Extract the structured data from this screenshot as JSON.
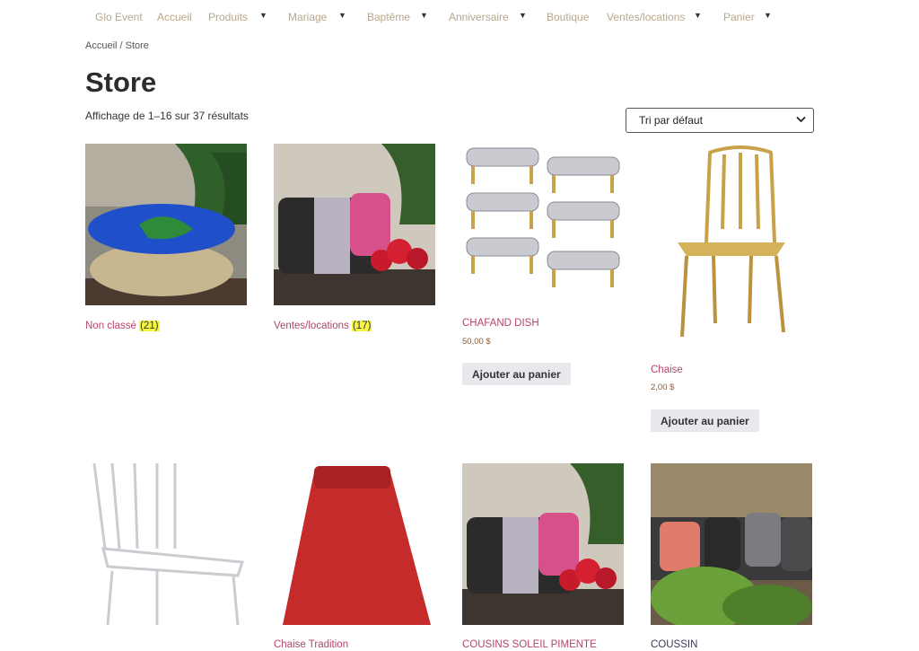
{
  "nav": {
    "items": [
      {
        "label": "Glo Event"
      },
      {
        "label": "Accueil"
      },
      {
        "label": "Produits"
      },
      {
        "label": "Mariage"
      },
      {
        "label": "Baptême"
      },
      {
        "label": "Anniversaire"
      },
      {
        "label": "Boutique"
      },
      {
        "label": "Ventes/locations"
      },
      {
        "label": "Panier"
      }
    ],
    "dropdown_symbol": "▼"
  },
  "breadcrumb": "Accueil / Store",
  "page_title": "Store",
  "result_count": "Affichage de 1–16 sur 37 résultats",
  "sort": {
    "selected": "Tri par défaut",
    "chevron": "⌄"
  },
  "categories": [
    {
      "name": "Non classé",
      "count": "(21)"
    },
    {
      "name": "Ventes/locations",
      "count": "(17)"
    }
  ],
  "products": [
    {
      "title": "CHAFAND DISH",
      "price": "50,00 $",
      "button": "Ajouter au panier"
    },
    {
      "title": "Chaise",
      "price": "2,00 $",
      "button": "Ajouter au panier"
    },
    {
      "title": "Chaise Tradition"
    },
    {
      "title": "COUSINS SOLEIL PIMENTE"
    },
    {
      "title": "COUSSIN"
    }
  ],
  "colors": {
    "nav_link": "#b8a78a",
    "product_title": "#b2456e",
    "button_bg": "#e8e8ed"
  }
}
